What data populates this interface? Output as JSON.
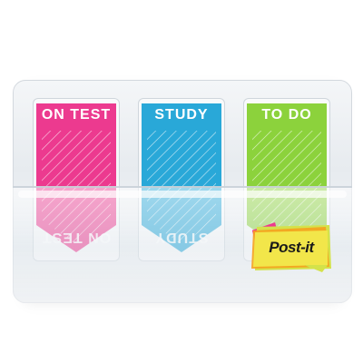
{
  "product": {
    "brand_logo": "Post-it",
    "flags": [
      {
        "label": "ON TEST",
        "color": "#ec3a8f"
      },
      {
        "label": "STUDY",
        "color": "#29a8d8"
      },
      {
        "label": "TO DO",
        "color": "#8cd23c"
      }
    ],
    "logo_colors": [
      "#f2e64a",
      "#f6a21e",
      "#d4e24a",
      "#ec3a8f"
    ]
  }
}
